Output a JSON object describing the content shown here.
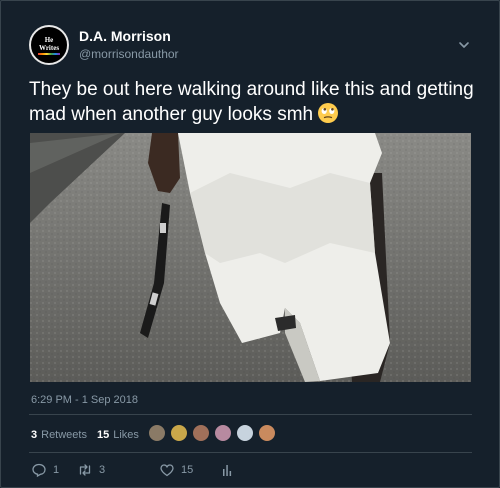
{
  "author": {
    "display_name": "D.A. Morrison",
    "handle": "@morrisondauthor",
    "avatar_text_line1": "He",
    "avatar_text_line2": "Writes"
  },
  "tweet": {
    "text": "They be out here walking around like this and getting mad when another guy looks smh",
    "emoji": "face-with-rolling-eyes",
    "media": {
      "type": "gif-video"
    },
    "timestamp": "6:29 PM - 1 Sep 2018"
  },
  "stats": {
    "retweets_count": "3",
    "retweets_label": "Retweets",
    "likes_count": "15",
    "likes_label": "Likes",
    "liker_avatar_colors": [
      "#8a7a66",
      "#c9a74a",
      "#a0705a",
      "#b78aa0",
      "#c7d3de",
      "#c98a5e"
    ]
  },
  "actions": {
    "reply_count": "1",
    "retweet_count": "3",
    "like_count": "15"
  },
  "colors": {
    "background": "#15202b",
    "secondary_text": "#8899a6",
    "divider": "#38444d"
  }
}
